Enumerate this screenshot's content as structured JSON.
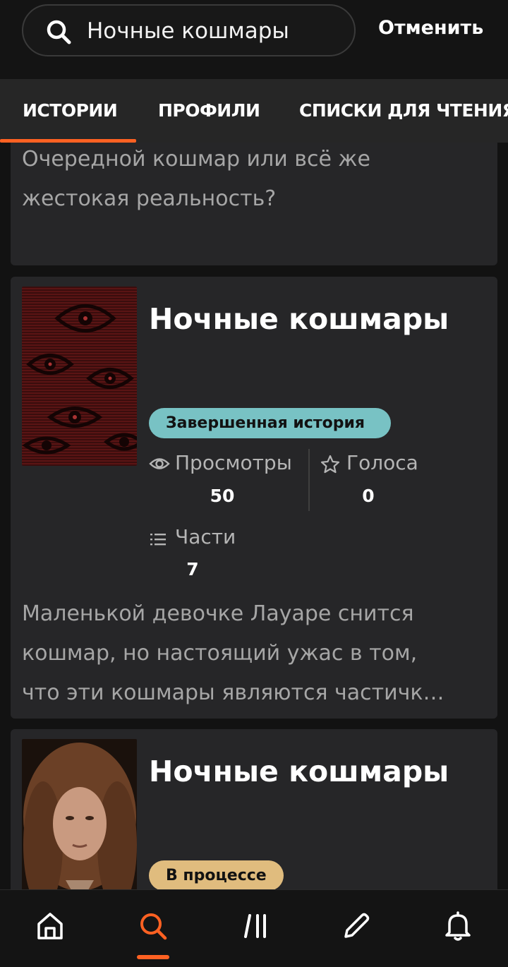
{
  "search": {
    "query": "Ночные кошмары",
    "cancel_label": "Отменить"
  },
  "tabs": [
    {
      "label": "ИСТОРИИ",
      "active": true
    },
    {
      "label": "ПРОФИЛИ",
      "active": false
    },
    {
      "label": "СПИСКИ ДЛЯ ЧТЕНИЯ",
      "active": false
    }
  ],
  "results": [
    {
      "description_lines": [
        "Очередной кошмар или всё же",
        "жестокая реальность?"
      ]
    },
    {
      "title": "Ночные кошмары",
      "status": "Завершенная история",
      "views_label": "Просмотры",
      "views": "50",
      "votes_label": "Голоса",
      "votes": "0",
      "parts_label": "Части",
      "parts": "7",
      "description_lines": [
        "Маленькой девочке Лауаре снится",
        "кошмар, но настоящий ужас в том,",
        "что эти кошмары являются частичк…"
      ]
    },
    {
      "title": "Ночные кошмары",
      "status": "В процессе"
    }
  ],
  "colors": {
    "accent": "#ff6122",
    "badge_complete": "#78c2c4",
    "badge_progress": "#e0bc7e"
  },
  "bottom_nav": [
    {
      "icon": "home-icon",
      "active": false
    },
    {
      "icon": "search-icon",
      "active": true
    },
    {
      "icon": "library-icon",
      "active": false
    },
    {
      "icon": "pencil-icon",
      "active": false
    },
    {
      "icon": "bell-icon",
      "active": false
    }
  ]
}
